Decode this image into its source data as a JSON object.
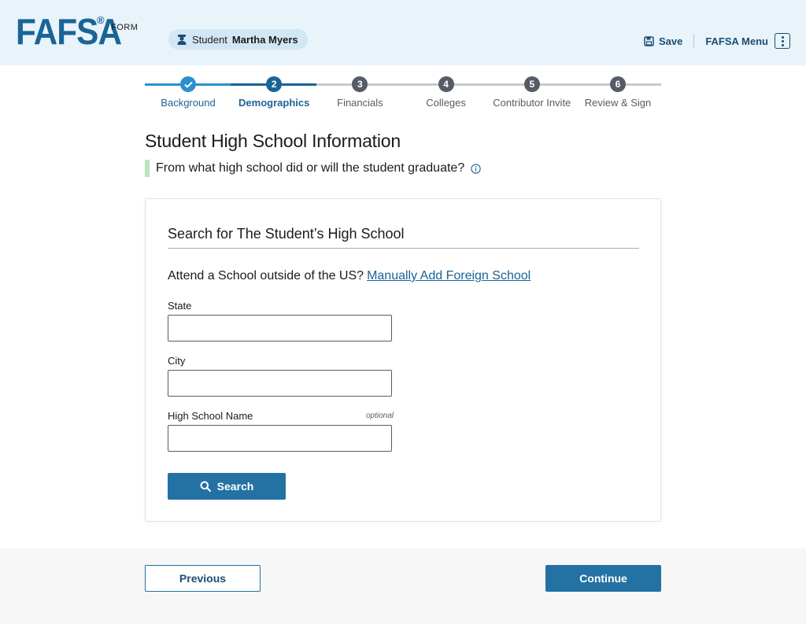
{
  "header": {
    "logo_text": "FAFSA",
    "logo_reg": "®",
    "logo_form": "FORM",
    "student_prefix": "Student",
    "student_name": "Martha Myers",
    "save_label": "Save",
    "menu_label": "FAFSA Menu",
    "icons": {
      "student": "student-icon",
      "save": "save-icon",
      "menu": "kebab-menu-icon"
    }
  },
  "stepper": {
    "steps": [
      {
        "number": "1",
        "label": "Background",
        "status": "complete"
      },
      {
        "number": "2",
        "label": "Demographics",
        "status": "current"
      },
      {
        "number": "3",
        "label": "Financials",
        "status": "upcoming"
      },
      {
        "number": "4",
        "label": "Colleges",
        "status": "upcoming"
      },
      {
        "number": "5",
        "label": "Contributor Invite",
        "status": "upcoming"
      },
      {
        "number": "6",
        "label": "Review & Sign",
        "status": "upcoming"
      }
    ],
    "colors": {
      "complete": "#2b8fd0",
      "current": "#1a6496",
      "upcoming": "#565c65",
      "line_upcoming": "#c7c9cb"
    }
  },
  "main": {
    "title": "Student High School Information",
    "question": "From what high school did or will the student graduate?"
  },
  "card": {
    "title": "Search for The Student’s High School",
    "foreign_prompt": "Attend a School outside of the US?",
    "foreign_link": "Manually Add Foreign School",
    "fields": {
      "state": {
        "label": "State",
        "value": ""
      },
      "city": {
        "label": "City",
        "value": ""
      },
      "school": {
        "label": "High School Name",
        "optional": "optional",
        "value": ""
      }
    },
    "search_label": "Search"
  },
  "footer": {
    "previous_label": "Previous",
    "continue_label": "Continue"
  }
}
